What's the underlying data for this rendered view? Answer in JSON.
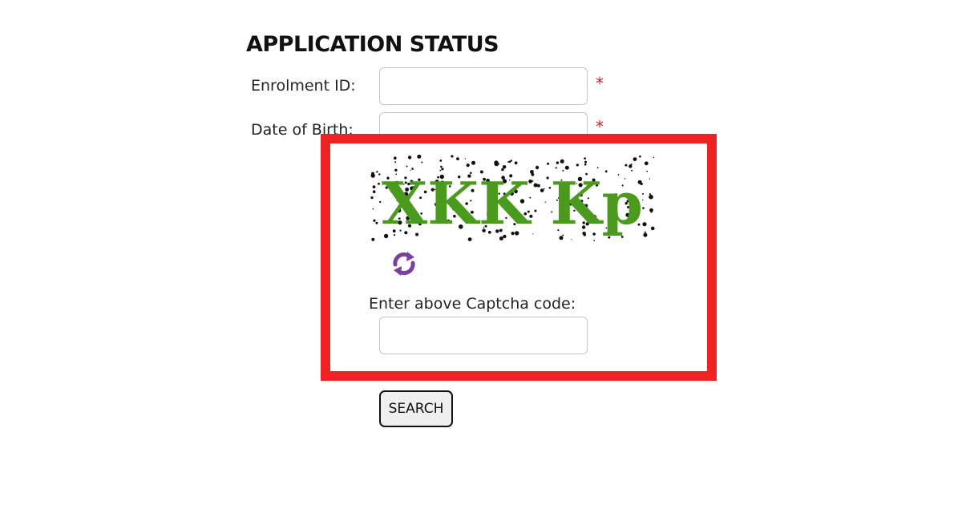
{
  "form": {
    "title": "APPLICATION STATUS",
    "enrolment_label": "Enrolment ID:",
    "enrolment_value": "",
    "dob_label": "Date of Birth:",
    "dob_value": "",
    "required_marker": "*",
    "captcha_text": "XKK Kp",
    "captcha_label": "Enter above Captcha code:",
    "captcha_value": "",
    "search_label": "SEARCH"
  },
  "icons": {
    "refresh": "refresh-icon"
  },
  "colors": {
    "highlight": "#ee2222",
    "captcha_text": "#4a9a1e",
    "refresh_icon": "#7a3fa0",
    "required": "#cc2222"
  }
}
